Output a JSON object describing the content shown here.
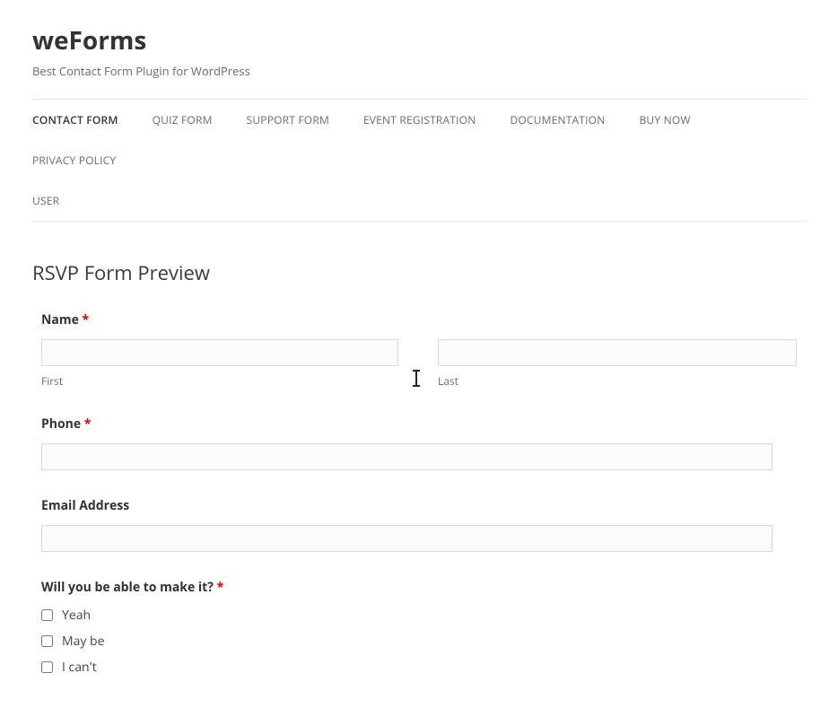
{
  "site": {
    "title": "weForms",
    "tagline": "Best Contact Form Plugin for WordPress"
  },
  "nav": {
    "items": [
      "CONTACT FORM",
      "QUIZ FORM",
      "SUPPORT FORM",
      "EVENT REGISTRATION",
      "DOCUMENTATION",
      "BUY NOW",
      "PRIVACY POLICY",
      "USER"
    ],
    "active_index": 0
  },
  "heading": "RSVP Form Preview",
  "fields": {
    "name": {
      "label": "Name",
      "required_mark": "*",
      "first_sub": "First",
      "last_sub": "Last",
      "first_value": "",
      "last_value": ""
    },
    "phone": {
      "label": "Phone",
      "required_mark": "*",
      "value": ""
    },
    "email": {
      "label": "Email Address",
      "value": ""
    },
    "attend": {
      "label": "Will you be able to make it?",
      "required_mark": "*",
      "options": [
        "Yeah",
        "May be",
        "I can't"
      ]
    }
  }
}
